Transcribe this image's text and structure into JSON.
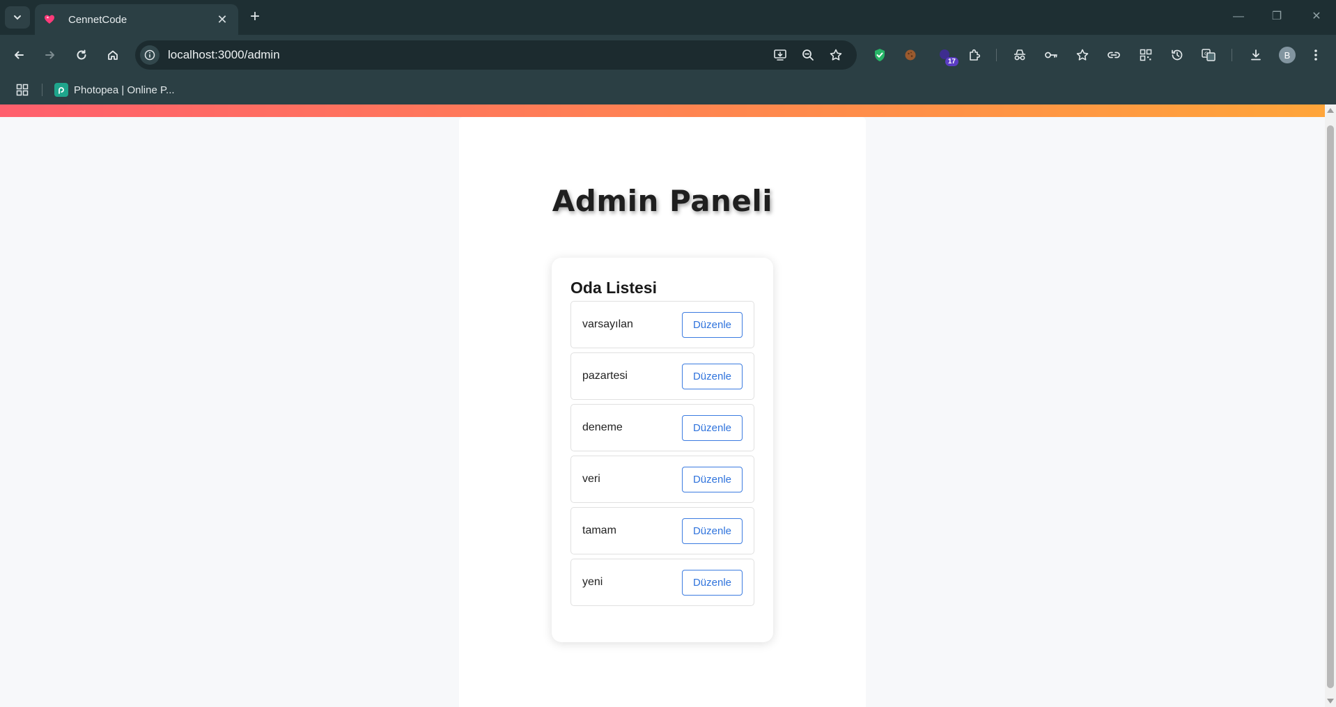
{
  "browser": {
    "tab": {
      "title": "CennetCode"
    },
    "omnibox": {
      "url": "localhost:3000/admin"
    },
    "extensions": {
      "badge_count": "17",
      "profile_initial": "B"
    },
    "bookmarks": [
      {
        "label": "Photopea | Online P..."
      }
    ]
  },
  "page": {
    "title": "Admin Paneli",
    "room_list": {
      "heading": "Oda Listesi",
      "edit_label": "Düzenle",
      "rooms": [
        {
          "name": "varsayılan"
        },
        {
          "name": "pazartesi"
        },
        {
          "name": "deneme"
        },
        {
          "name": "veri"
        },
        {
          "name": "tamam"
        },
        {
          "name": "yeni"
        }
      ]
    }
  },
  "colors": {
    "gradient_start": "#ff5f6d",
    "gradient_end": "#ffa53a",
    "button_accent": "#2f73dc",
    "chrome_bg": "#2b3f44"
  },
  "icons": {
    "tab_favicon": "heart-icon",
    "nav": [
      "back-arrow-icon",
      "forward-arrow-icon",
      "reload-icon",
      "home-icon"
    ],
    "omnibox_actions": [
      "install-app-icon",
      "zoom-icon",
      "bookmark-star-icon"
    ],
    "extensions": [
      "shield-extension-icon",
      "cookie-extension-icon",
      "bubble-extension-icon",
      "puzzle-extension-icon",
      "incognito-icon",
      "key-icon",
      "star-list-icon",
      "link-icon",
      "qr-code-icon",
      "history-icon",
      "translate-icon",
      "download-icon",
      "kebab-menu-icon"
    ]
  }
}
